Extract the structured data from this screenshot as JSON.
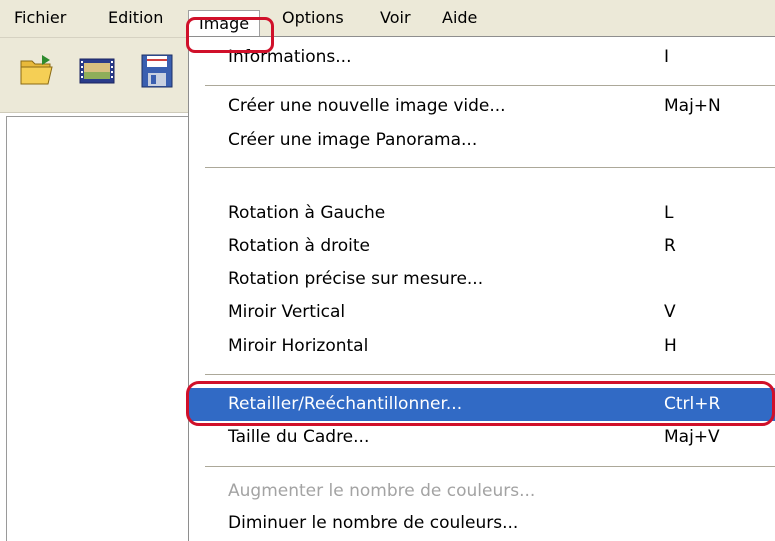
{
  "menubar": {
    "items": [
      "Fichier",
      "Edition",
      "Image",
      "Options",
      "Voir",
      "Aide"
    ],
    "active": "Image"
  },
  "toolbar": {
    "buttons": [
      {
        "icon": "open-folder-icon"
      },
      {
        "icon": "slideshow-icon"
      },
      {
        "icon": "save-icon"
      }
    ]
  },
  "image_menu": {
    "groups": [
      [
        {
          "label": "Informations...",
          "shortcut": "I"
        }
      ],
      [
        {
          "label": "Créer une nouvelle image vide...",
          "shortcut": "Maj+N"
        },
        {
          "label": "Créer une image Panorama...",
          "shortcut": ""
        }
      ],
      [
        {
          "label": "Rotation à Gauche",
          "shortcut": "L"
        },
        {
          "label": "Rotation à droite",
          "shortcut": "R"
        },
        {
          "label": "Rotation précise sur mesure...",
          "shortcut": ""
        },
        {
          "label": "Miroir Vertical",
          "shortcut": "V"
        },
        {
          "label": "Miroir Horizontal",
          "shortcut": "H"
        }
      ],
      [
        {
          "label": "Retailler/Reéchantillonner...",
          "shortcut": "Ctrl+R",
          "selected": true
        },
        {
          "label": "Taille du Cadre...",
          "shortcut": "Maj+V"
        }
      ],
      [
        {
          "label": "Augmenter le nombre de couleurs...",
          "shortcut": "",
          "disabled": true
        },
        {
          "label": "Diminuer le nombre de couleurs...",
          "shortcut": ""
        }
      ]
    ]
  },
  "colors": {
    "menu_bar_bg": "#ece9d8",
    "selection_bg": "#316ac5",
    "annotation_red": "#d0102a",
    "disabled_text": "#a3a3a3"
  }
}
